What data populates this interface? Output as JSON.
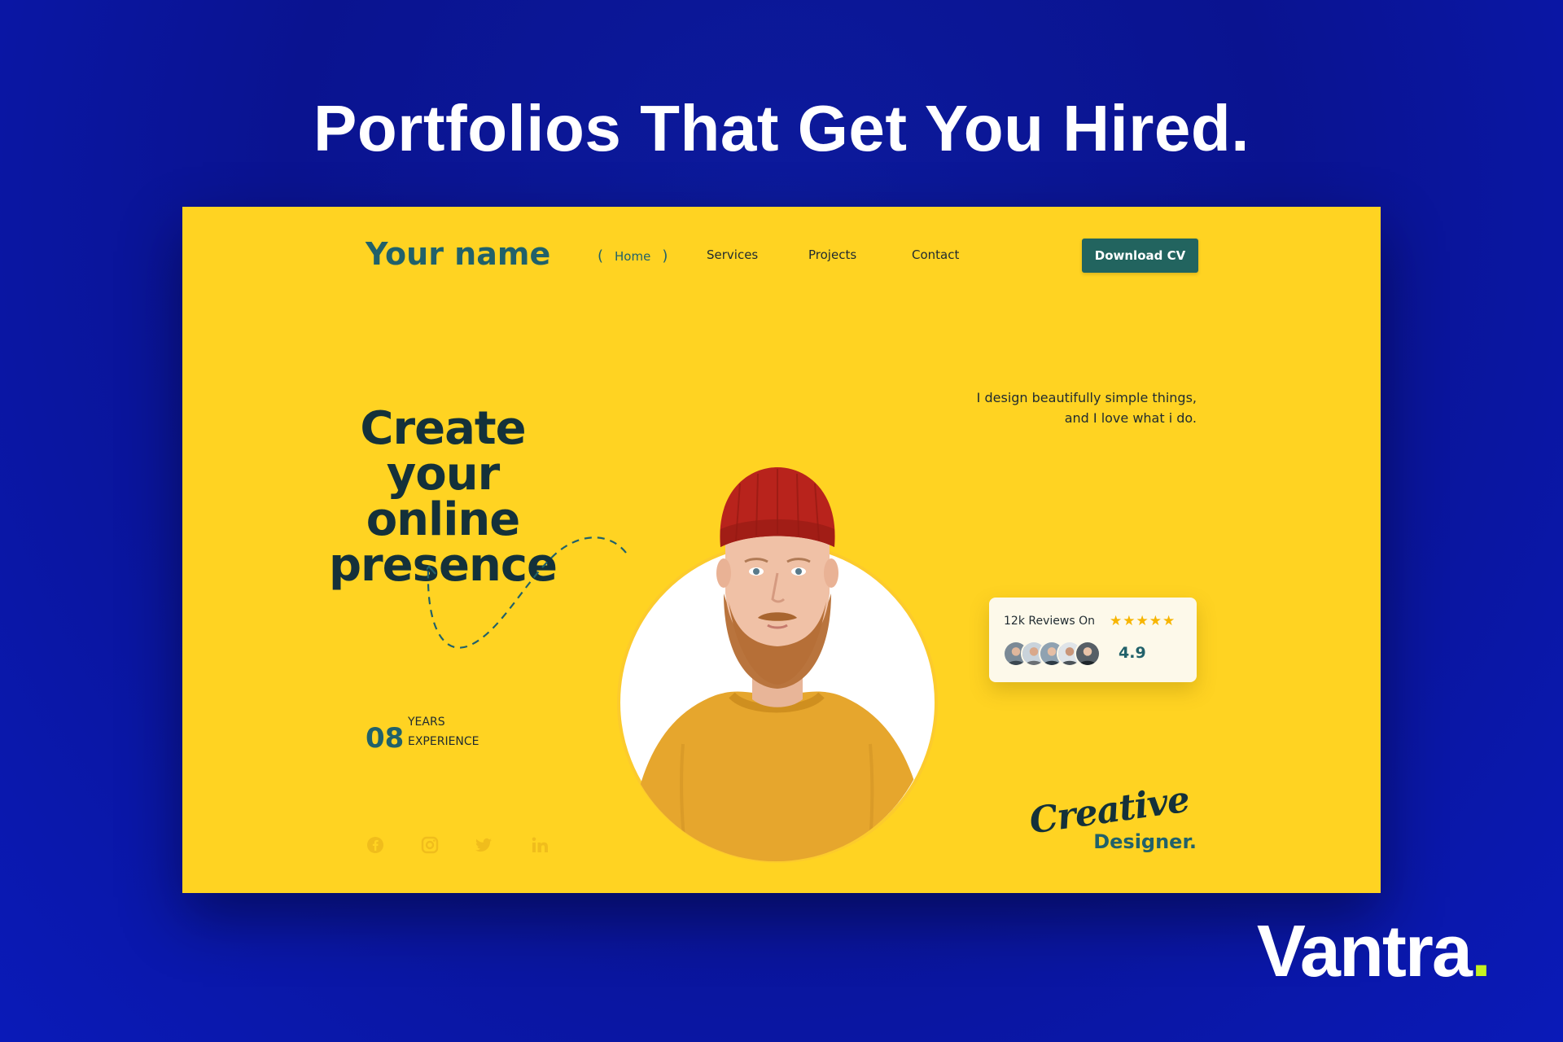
{
  "headline": "Portfolios That Get You Hired.",
  "site": {
    "brand": "Your name",
    "nav": {
      "paren_open": "(",
      "home": "Home",
      "paren_close": ")",
      "services": "Services",
      "projects": "Projects",
      "contact": "Contact"
    },
    "download_cv": "Download CV",
    "hero": {
      "line1": "Create",
      "line2": "your online",
      "line3": "presence"
    },
    "tagline": {
      "line1": "I design beautifully simple things,",
      "line2": "and I love what i do."
    },
    "experience": {
      "number": "08",
      "line1": "YEARS",
      "line2": "EXPERIENCE"
    },
    "socials": [
      "facebook-icon",
      "instagram-icon",
      "twitter-icon",
      "linkedin-icon"
    ],
    "reviews": {
      "label": "12k Reviews On",
      "stars": "★★★★★",
      "rating": "4.9"
    },
    "creative": "Creative",
    "designer": "Designer."
  },
  "logo": {
    "text": "Vantra",
    "dot": "."
  },
  "colors": {
    "background": "#0a1390",
    "yellow": "#ffd322",
    "teal": "#21616a",
    "button": "#22645f",
    "dark": "#14313a",
    "star": "#f7b500",
    "accent_dot": "#c6f21f"
  }
}
